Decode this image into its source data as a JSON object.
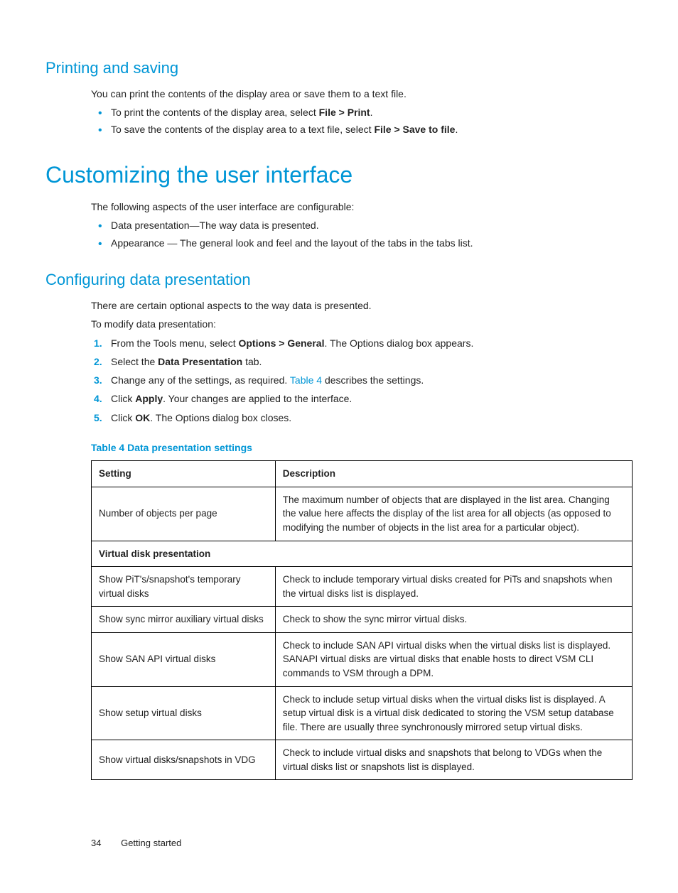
{
  "section1": {
    "heading": "Printing and saving",
    "intro": "You can print the contents of the display area or save them to a text file.",
    "bullets": [
      {
        "pre": "To print the contents of the display area, select ",
        "bold": "File > Print",
        "post": "."
      },
      {
        "pre": "To save the contents of the display area to a text file, select ",
        "bold": "File > Save to file",
        "post": "."
      }
    ]
  },
  "section2": {
    "heading": "Customizing the user interface",
    "intro": "The following aspects of the user interface are configurable:",
    "bullets": [
      "Data presentation—The way data is presented.",
      "Appearance — The general look and feel and the layout of the tabs in the tabs list."
    ]
  },
  "section3": {
    "heading": "Configuring data presentation",
    "p1": "There are certain optional aspects to the way data is presented.",
    "p2": "To modify data presentation:",
    "steps": [
      {
        "pre": "From the Tools menu, select ",
        "bold": "Options > General",
        "post": ". The Options dialog box appears."
      },
      {
        "pre": "Select the ",
        "bold": "Data Presentation",
        "post": " tab."
      },
      {
        "pre": "Change any of the settings, as required. ",
        "link": "Table 4",
        "post": " describes the settings."
      },
      {
        "pre": "Click ",
        "bold": "Apply",
        "post": ". Your changes are applied to the interface."
      },
      {
        "pre": "Click ",
        "bold": "OK",
        "post": ". The Options dialog box closes."
      }
    ],
    "table_caption": "Table 4 Data presentation settings",
    "table": {
      "headers": [
        "Setting",
        "Description"
      ],
      "rows": [
        {
          "type": "data",
          "setting": "Number of objects per page",
          "desc": "The maximum number of objects that are displayed in the list area. Changing the value here affects the display of the list area for all objects (as opposed to modifying the number of objects in the list area for a particular object)."
        },
        {
          "type": "section",
          "label": "Virtual disk presentation"
        },
        {
          "type": "data",
          "setting": "Show PiT's/snapshot's temporary virtual disks",
          "desc": "Check to include temporary virtual disks created for PiTs and snapshots when the virtual disks list is displayed."
        },
        {
          "type": "data",
          "setting": "Show sync mirror auxiliary virtual disks",
          "desc": "Check to show the sync mirror virtual disks."
        },
        {
          "type": "data",
          "setting": "Show SAN API virtual disks",
          "desc": "Check to include SAN API virtual disks when the virtual disks list is displayed. SANAPI virtual disks are virtual disks that enable hosts to direct VSM CLI commands to VSM through a DPM."
        },
        {
          "type": "data",
          "setting": "Show setup virtual disks",
          "desc": "Check to include setup virtual disks when the virtual disks list is displayed. A setup virtual disk is a virtual disk dedicated to storing the VSM setup database file. There are usually three synchronously mirrored setup virtual disks."
        },
        {
          "type": "data",
          "setting": "Show virtual disks/snapshots in VDG",
          "desc": "Check to include virtual disks and snapshots that belong to VDGs when the virtual disks list or snapshots list is displayed."
        }
      ]
    }
  },
  "footer": {
    "page": "34",
    "chapter": "Getting started"
  }
}
